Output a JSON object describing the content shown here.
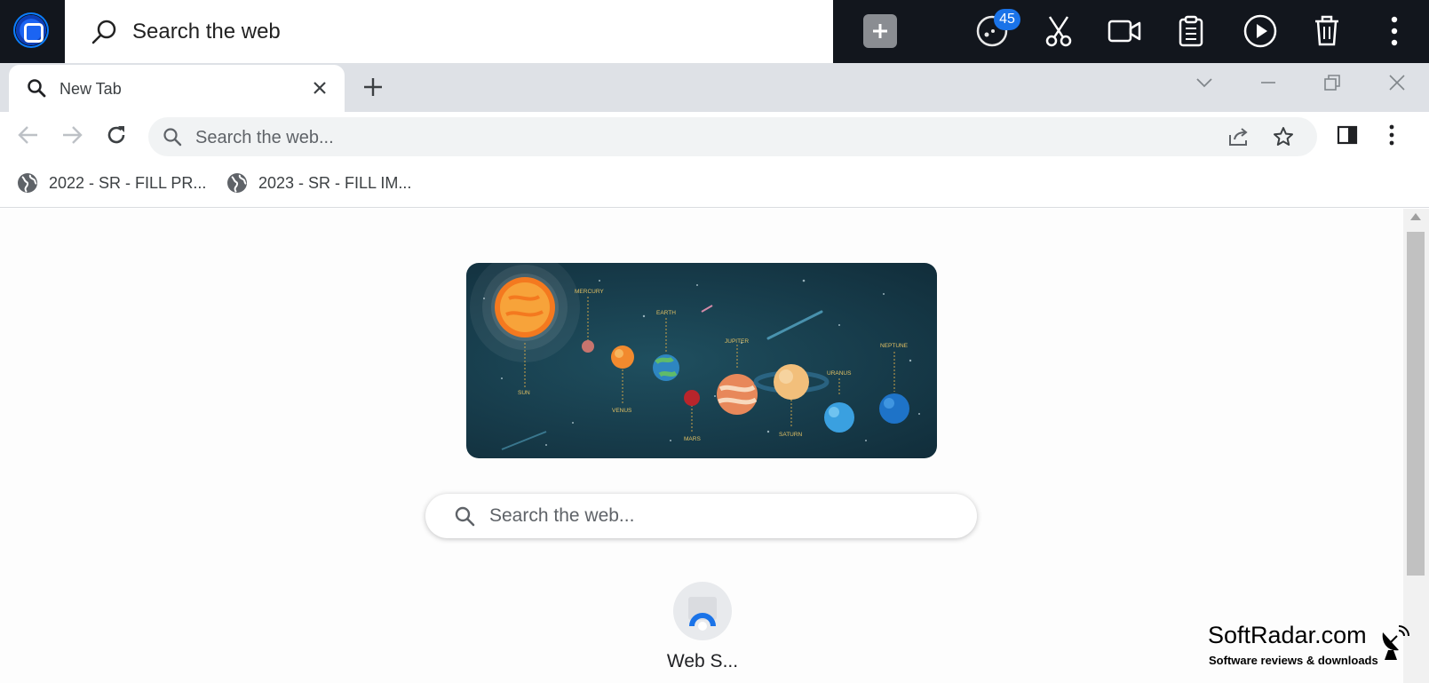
{
  "topbar": {
    "search_text": "Search the web",
    "badge_count": "45"
  },
  "tab": {
    "title": "New Tab"
  },
  "omnibox": {
    "placeholder": "Search the web..."
  },
  "bookmarks": [
    {
      "label": "2022 - SR - FILL PR..."
    },
    {
      "label": "2023 - SR - FILL IM..."
    }
  ],
  "banner": {
    "planets": [
      "SUN",
      "MERCURY",
      "VENUS",
      "EARTH",
      "MARS",
      "JUPITER",
      "SATURN",
      "URANUS",
      "NEPTUNE"
    ]
  },
  "main_search": {
    "placeholder": "Search the web..."
  },
  "shortcuts": [
    {
      "label": "Web S..."
    }
  ],
  "watermark": {
    "title": "SoftRadar.com",
    "subtitle": "Software reviews & downloads"
  },
  "colors": {
    "accent": "#1a73e8",
    "topbar_bg": "#12161d",
    "tabstrip_bg": "#dee1e6",
    "banner_bg": "#173c4b"
  }
}
